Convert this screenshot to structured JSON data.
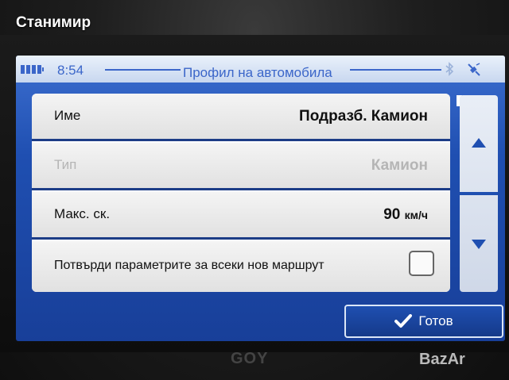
{
  "watermark": {
    "username": "Станимир",
    "site": "BazAr"
  },
  "device": {
    "brand": "GOY"
  },
  "status_bar": {
    "time": "8:54",
    "title": "Профил на автомобила",
    "icons": [
      "battery-icon",
      "bluetooth-icon",
      "gps-satellite-icon"
    ]
  },
  "settings": {
    "name_label": "Име",
    "name_value": "Подразб. Камион",
    "type_label": "Тип",
    "type_value": "Камион",
    "speed_label": "Макс. ск.",
    "speed_value": "90",
    "speed_unit": "км/ч",
    "confirm_label": "Потвърди параметрите за всеки нов маршрут",
    "confirm_checked": false
  },
  "scroll": {
    "up_icon": "triangle-up-icon",
    "down_icon": "triangle-down-icon"
  },
  "footer": {
    "done_label": "Готов",
    "done_icon": "checkmark-icon"
  },
  "colors": {
    "accent": "#1f4fb1",
    "title_text": "#3b66c9",
    "disabled_text": "#b5b5b5"
  }
}
